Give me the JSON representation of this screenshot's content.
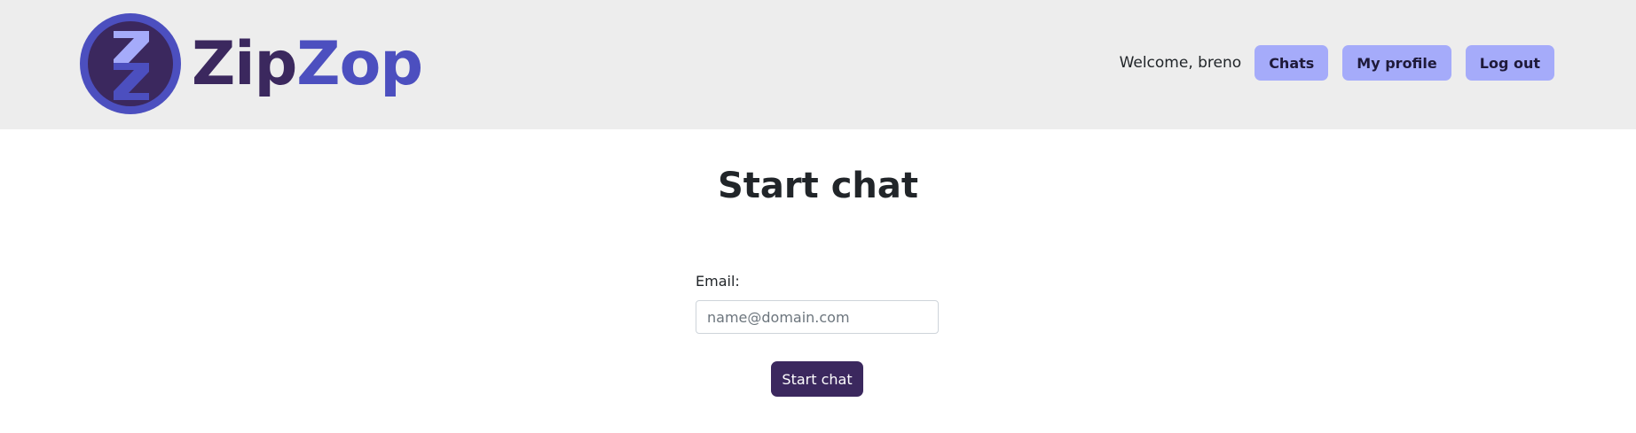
{
  "header": {
    "logo_icon": "zipzop-logo-icon",
    "brand_part1": "Zip",
    "brand_part2": "Zop",
    "welcome_text": "Welcome, breno",
    "nav": {
      "chats_label": "Chats",
      "profile_label": "My profile",
      "logout_label": "Log out"
    }
  },
  "main": {
    "title": "Start chat",
    "email_label": "Email:",
    "email_placeholder": "name@domain.com",
    "email_value": "",
    "submit_label": "Start chat"
  },
  "colors": {
    "header_bg": "#ededed",
    "brand_dark": "#3b285e",
    "brand_accent": "#4c4fbf",
    "nav_button_bg": "#a5abfa",
    "primary_button_bg": "#3b285e"
  }
}
